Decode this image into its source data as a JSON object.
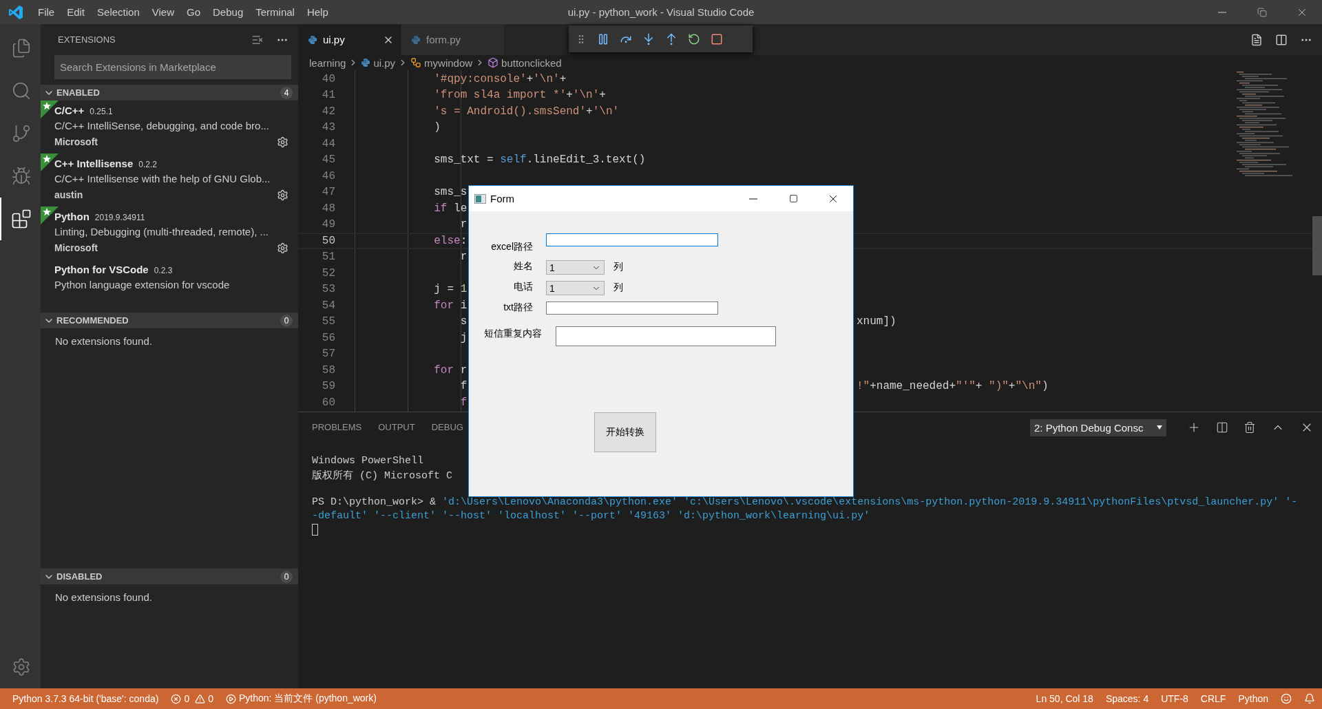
{
  "window": {
    "title": "ui.py - python_work - Visual Studio Code"
  },
  "menu": [
    "File",
    "Edit",
    "Selection",
    "View",
    "Go",
    "Debug",
    "Terminal",
    "Help"
  ],
  "activity_bar": [
    {
      "selected": false
    },
    {
      "selected": false
    },
    {
      "selected": false
    },
    {
      "selected": false
    },
    {
      "selected": true
    }
  ],
  "sidebar": {
    "title": "EXTENSIONS",
    "search": {
      "placeholder": "Search Extensions in Marketplace"
    },
    "sections": [
      {
        "title": "ENABLED",
        "count": "4",
        "expanded": true,
        "items": [
          {
            "name": "C/C++",
            "version": "0.25.1",
            "description": "C/C++ IntelliSense, debugging, and code bro...",
            "publisher": "Microsoft",
            "recommended": true
          },
          {
            "name": "C++ Intellisense",
            "version": "0.2.2",
            "description": "C/C++ Intellisense with the help of GNU Glob...",
            "publisher": "austin",
            "recommended": true
          },
          {
            "name": "Python",
            "version": "2019.9.34911",
            "description": "Linting, Debugging (multi-threaded, remote), ...",
            "publisher": "Microsoft",
            "recommended": true
          },
          {
            "name": "Python for VSCode",
            "version": "0.2.3",
            "description": "Python language extension for vscode",
            "recommended": false
          }
        ]
      },
      {
        "title": "RECOMMENDED",
        "count": "0",
        "expanded": true,
        "empty_text": "No extensions found."
      },
      {
        "title": "DISABLED",
        "count": "0",
        "expanded": true,
        "empty_text": "No extensions found."
      }
    ]
  },
  "editor": {
    "tabs": [
      {
        "label": "ui.py",
        "selected": true
      },
      {
        "label": "form.py",
        "selected": false
      }
    ],
    "breadcrumb": [
      "learning",
      "ui.py",
      "mywindow",
      "buttonclicked"
    ],
    "lines": [
      {
        "number": "40",
        "current": false,
        "code": [
          {
            "kind": "string",
            "text": "            '#qpy:console'"
          },
          {
            "kind": "plain",
            "text": "+"
          },
          {
            "kind": "string",
            "text": "'\\n'"
          },
          {
            "kind": "plain",
            "text": "+"
          }
        ]
      },
      {
        "number": "41",
        "current": false,
        "code": [
          {
            "kind": "string",
            "text": "            'from sl4a import *'"
          },
          {
            "kind": "plain",
            "text": "+"
          },
          {
            "kind": "string",
            "text": "'\\n'"
          },
          {
            "kind": "plain",
            "text": "+"
          }
        ]
      },
      {
        "number": "42",
        "current": false,
        "code": [
          {
            "kind": "string",
            "text": "            's = Android().smsSend'"
          },
          {
            "kind": "plain",
            "text": "+"
          },
          {
            "kind": "string",
            "text": "'\\n'"
          }
        ]
      },
      {
        "number": "43",
        "current": false,
        "code": [
          {
            "kind": "plain",
            "text": "            )"
          }
        ]
      },
      {
        "number": "44",
        "current": false
      },
      {
        "number": "45",
        "current": false,
        "code": [
          {
            "kind": "plain",
            "text": "            sms_txt = "
          },
          {
            "kind": "self",
            "text": "self"
          },
          {
            "kind": "plain",
            "text": ".lineEdit_3.text()"
          }
        ]
      },
      {
        "number": "46",
        "current": false
      },
      {
        "number": "47",
        "current": false,
        "code": [
          {
            "kind": "plain",
            "text": "            sms_s"
          }
        ]
      },
      {
        "number": "48",
        "current": false,
        "code": [
          {
            "kind": "keyword",
            "text": "            if"
          },
          {
            "kind": "plain",
            "text": " le"
          }
        ]
      },
      {
        "number": "49",
        "current": false,
        "code": [
          {
            "kind": "plain",
            "text": "                r"
          }
        ]
      },
      {
        "number": "50",
        "current": true,
        "code": [
          {
            "kind": "keyword",
            "text": "            else"
          },
          {
            "kind": "plain",
            "text": ":"
          }
        ]
      },
      {
        "number": "51",
        "current": false,
        "code": [
          {
            "kind": "plain",
            "text": "                r"
          }
        ]
      },
      {
        "number": "52",
        "current": false
      },
      {
        "number": "53",
        "current": false,
        "code": [
          {
            "kind": "plain",
            "text": "            j = "
          },
          {
            "kind": "number",
            "text": "1"
          }
        ]
      },
      {
        "number": "54",
        "current": false,
        "code": [
          {
            "kind": "keyword",
            "text": "            for"
          },
          {
            "kind": "plain",
            "text": " i"
          }
        ]
      },
      {
        "number": "55",
        "current": false,
        "code": [
          {
            "kind": "plain",
            "text": "                s"
          }
        ],
        "after": [
          {
            "kind": "plain",
            "text": "xnum])"
          }
        ]
      },
      {
        "number": "56",
        "current": false,
        "code": [
          {
            "kind": "plain",
            "text": "                j"
          }
        ]
      },
      {
        "number": "57",
        "current": false
      },
      {
        "number": "58",
        "current": false,
        "code": [
          {
            "kind": "keyword",
            "text": "            for"
          },
          {
            "kind": "plain",
            "text": " r"
          }
        ]
      },
      {
        "number": "59",
        "current": false,
        "code": [
          {
            "kind": "plain",
            "text": "                f"
          }
        ],
        "after": [
          {
            "kind": "string",
            "text": "!\""
          },
          {
            "kind": "plain",
            "text": "+name_needed+"
          },
          {
            "kind": "string",
            "text": "\"'\""
          },
          {
            "kind": "plain",
            "text": "+ "
          },
          {
            "kind": "string",
            "text": "\")\""
          },
          {
            "kind": "plain",
            "text": "+"
          },
          {
            "kind": "string",
            "text": "\"\\n\""
          },
          {
            "kind": "plain",
            "text": ")"
          }
        ]
      },
      {
        "number": "60",
        "current": false,
        "code": [
          {
            "kind": "keyword",
            "text": "                f"
          }
        ]
      }
    ]
  },
  "panel": {
    "tabs": [
      {
        "label": "PROBLEMS",
        "selected": false
      },
      {
        "label": "OUTPUT",
        "selected": false
      },
      {
        "label": "DEBUG",
        "selected": false
      }
    ],
    "terminal_select": "2: Python Debug Consc",
    "terminal": [
      [
        [
          {
            "kind": "plain",
            "text": "Windows PowerShell"
          }
        ],
        [
          {
            "kind": "plain",
            "text": "版权所有 (C) Microsoft C"
          }
        ]
      ],
      [
        [
          {
            "kind": "plain",
            "text": "PS D:\\python_work> & "
          },
          {
            "kind": "string",
            "text": "'d:\\Users\\Lenovo\\Anaconda3\\python.exe' 'c:\\Users\\Lenovo\\.vscode\\extensions\\ms-python.python-2019.9.34911\\pythonFiles\\ptvsd_launcher.py' '-"
          }
        ],
        [
          {
            "kind": "string",
            "text": "-default' '--client' '--host' 'localhost' '--port' '49163' 'd:\\python_work\\learning\\ui.py'"
          }
        ]
      ]
    ]
  },
  "form": {
    "title": "Form",
    "fields": [
      {
        "kind": "text",
        "label": "excel路径",
        "focused": true
      },
      {
        "kind": "combo",
        "label": "姓名",
        "value": "1",
        "unit": "列"
      },
      {
        "kind": "combo",
        "label": "电话",
        "value": "1",
        "unit": "列"
      },
      {
        "kind": "text",
        "label": "txt路径",
        "focused": false
      },
      {
        "kind": "textarea",
        "label": "短信重复内容",
        "focused": false
      }
    ],
    "button": "开始转换"
  },
  "status_bar": {
    "left": [
      {
        "kind": "text",
        "text": "Python 3.7.3 64-bit ('base': conda)"
      },
      {
        "kind": "problems",
        "errors": "0",
        "warnings": "0"
      },
      {
        "kind": "debug",
        "text": "Python: 当前文件 (python_work)"
      }
    ],
    "right": [
      "Ln 50, Col 18",
      "Spaces: 4",
      "UTF-8",
      "CRLF",
      "Python"
    ]
  }
}
